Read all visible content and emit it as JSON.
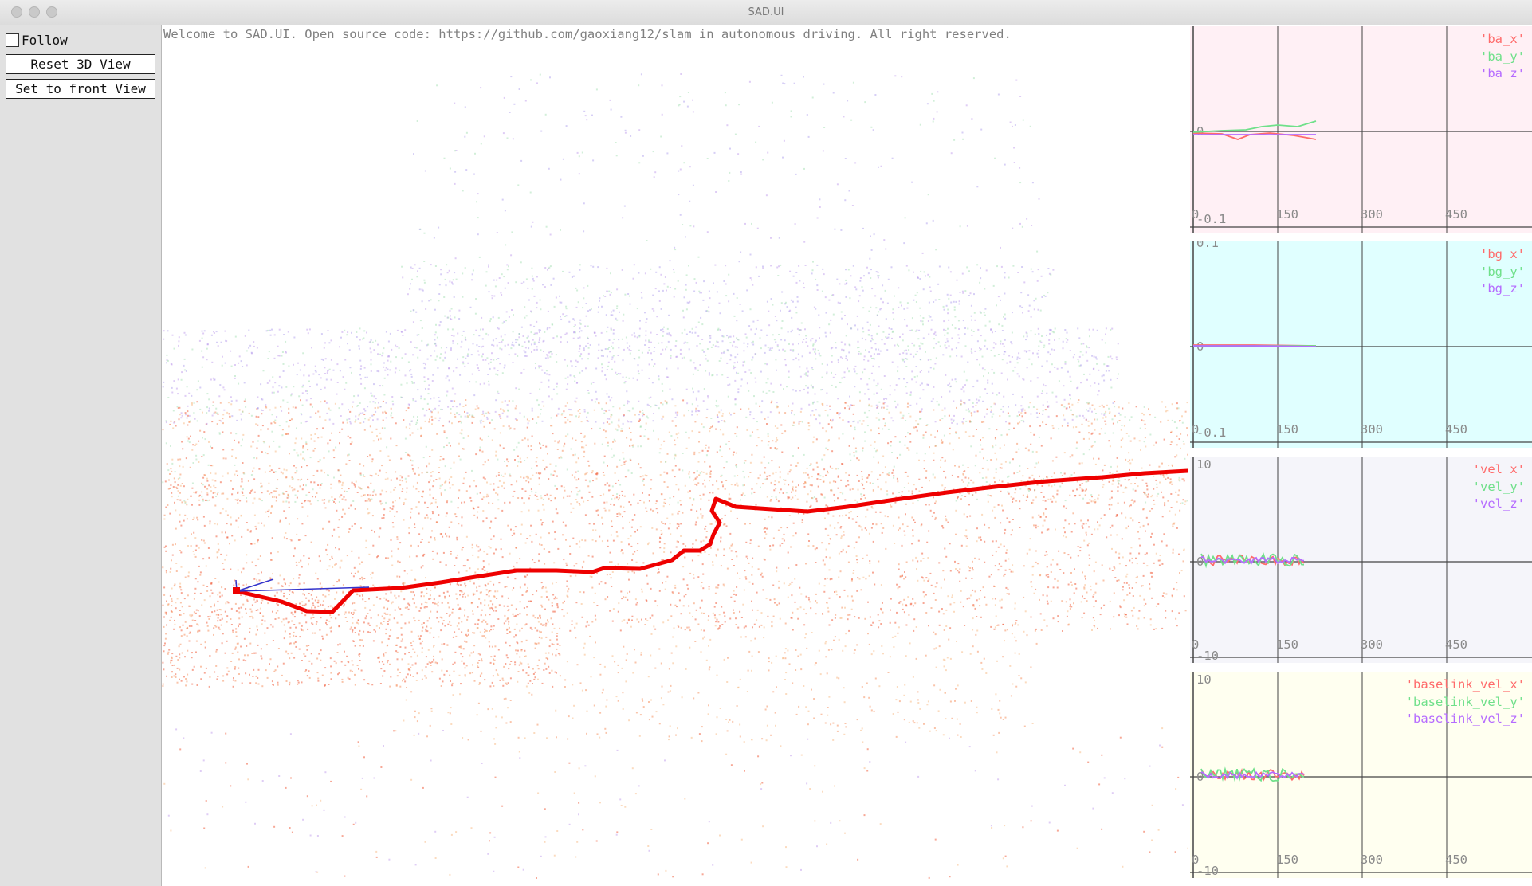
{
  "window": {
    "title": "SAD.UI",
    "traffic_lights": [
      "close",
      "minimize",
      "zoom"
    ]
  },
  "sidebar": {
    "follow": {
      "label": "Follow",
      "checked": false
    },
    "buttons": [
      {
        "label": "Reset 3D View"
      },
      {
        "label": "Set to front View"
      }
    ]
  },
  "viewport": {
    "welcome_text": "Welcome to SAD.UI. Open source code: https://github.com/gaoxiang12/slam_in_autonomous_driving. All right reserved."
  },
  "plots": [
    {
      "name": "plot-ba",
      "background": "#fff0f5",
      "legend": [
        "'ba_x'",
        "'ba_y'",
        "'ba_z'"
      ],
      "x_ticks": [
        "0",
        "150",
        "300",
        "450"
      ],
      "y_ticks": [
        "0",
        "-0.1"
      ]
    },
    {
      "name": "plot-bg",
      "background": "#e0ffff",
      "legend": [
        "'bg_x'",
        "'bg_y'",
        "'bg_z'"
      ],
      "x_ticks": [
        "0",
        "150",
        "300",
        "450"
      ],
      "y_ticks": [
        "0.1",
        "0",
        "-0.1"
      ]
    },
    {
      "name": "plot-vel",
      "background": "#f5f5fa",
      "legend": [
        "'vel_x'",
        "'vel_y'",
        "'vel_z'"
      ],
      "x_ticks": [
        "0",
        "150",
        "300",
        "450"
      ],
      "y_ticks": [
        "10",
        "0",
        "-10"
      ]
    },
    {
      "name": "plot-baselink-vel",
      "background": "#fffff0",
      "legend": [
        "'baselink_vel_x'",
        "'baselink_vel_y'",
        "'baselink_vel_z'"
      ],
      "x_ticks": [
        "0",
        "150",
        "300",
        "450"
      ],
      "y_ticks": [
        "10",
        "0",
        "-10"
      ]
    }
  ],
  "colors": {
    "series_x": "#ff6b6b",
    "series_y": "#6fe08a",
    "series_z": "#b56bff",
    "trajectory": "#ee0000",
    "pose": "#3333cc"
  }
}
